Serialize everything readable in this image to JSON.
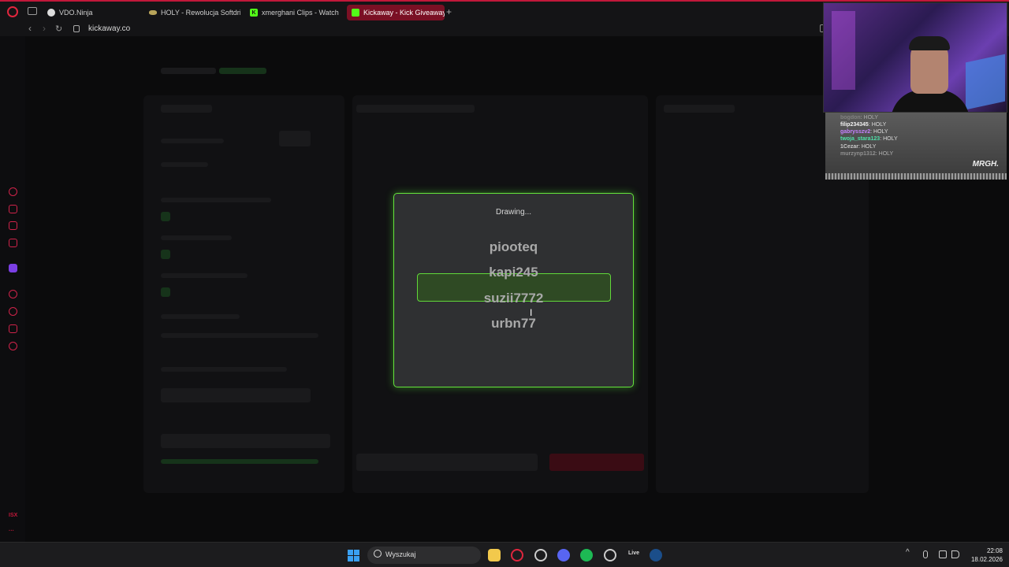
{
  "browser": {
    "tabs": [
      {
        "title": "VDO.Ninja",
        "icon": "vdo-ninja-icon",
        "color": "#dddddd"
      },
      {
        "title": "HOLY - Rewolucja Softdri",
        "icon": "holy-icon",
        "color": "#b8a45a"
      },
      {
        "title": "xmerghani Clips - Watch L",
        "icon": "kick-icon",
        "color": "#53fc18"
      },
      {
        "title": "Kickaway - Kick Giveaway",
        "icon": "kickaway-icon",
        "color": "#53fc18"
      }
    ],
    "url": "kickaway.co",
    "accent": "#c2183a"
  },
  "modal": {
    "status": "Drawing...",
    "names": [
      "piooteq",
      "kapi245",
      "suzii7772",
      "urbn77"
    ],
    "border_color": "#63e33b"
  },
  "chat": {
    "messages": [
      {
        "user": "bogdon",
        "text": "HOLY",
        "user_color": "#9a9a9a"
      },
      {
        "user": "filip234345",
        "text": "HOLY",
        "user_color": "#f2f2f2"
      },
      {
        "user": "gabrysszv2",
        "text": "HOLY",
        "user_color": "#c580ff"
      },
      {
        "user": "twoja_stara123",
        "text": "HOLY",
        "user_color": "#4fe0a8"
      },
      {
        "user": "1Cezar",
        "text": "HOLY",
        "user_color": "#c8c8c8"
      },
      {
        "user": "murzynp1312",
        "text": "HOLY",
        "user_color": "#b0b0b0"
      }
    ],
    "logo": "MRGH."
  },
  "taskbar": {
    "search_placeholder": "Wyszukaj",
    "live_label": "Live",
    "time": "22:08",
    "date": "18.02.2026"
  },
  "sidebar": {
    "bottom_label": "ISX"
  }
}
